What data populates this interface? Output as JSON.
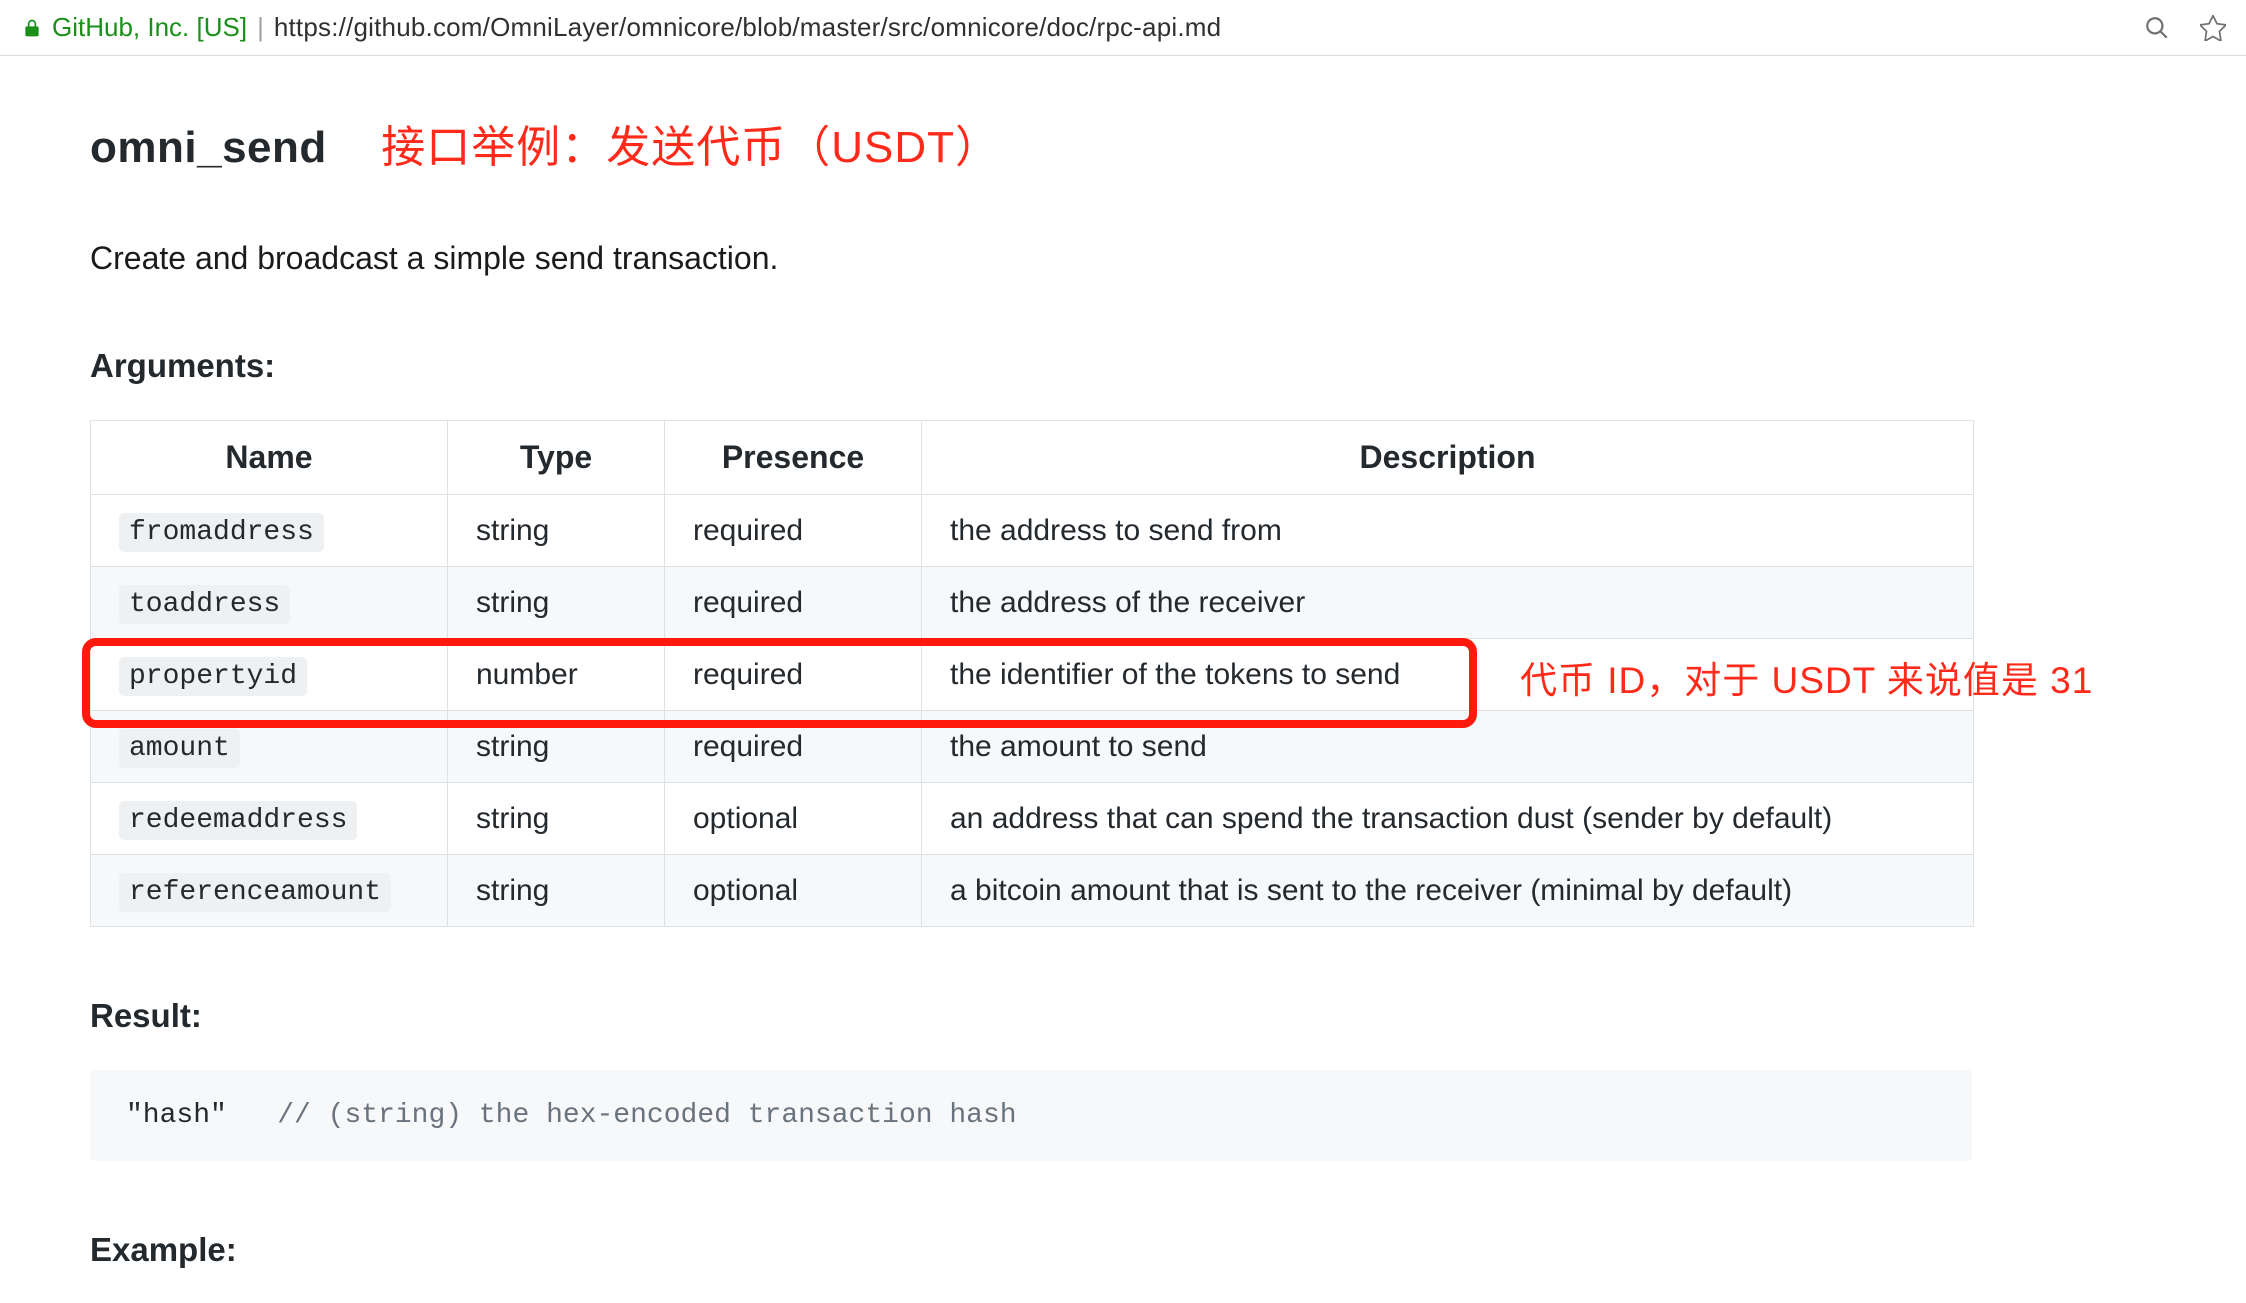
{
  "urlbar": {
    "cert": "GitHub, Inc. [US]",
    "url": "https://github.com/OmniLayer/omnicore/blob/master/src/omnicore/doc/rpc-api.md"
  },
  "doc": {
    "heading": "omni_send",
    "annotation_heading": "接口举例：发送代币（USDT）",
    "lead": "Create and broadcast a simple send transaction.",
    "arguments_label": "Arguments:",
    "result_label": "Result:",
    "example_label": "Example:",
    "table_headers": {
      "name": "Name",
      "type": "Type",
      "presence": "Presence",
      "description": "Description"
    },
    "args": [
      {
        "name": "fromaddress",
        "type": "string",
        "presence": "required",
        "description": "the address to send from"
      },
      {
        "name": "toaddress",
        "type": "string",
        "presence": "required",
        "description": "the address of the receiver"
      },
      {
        "name": "propertyid",
        "type": "number",
        "presence": "required",
        "description": "the identifier of the tokens to send"
      },
      {
        "name": "amount",
        "type": "string",
        "presence": "required",
        "description": "the amount to send"
      },
      {
        "name": "redeemaddress",
        "type": "string",
        "presence": "optional",
        "description": "an address that can spend the transaction dust (sender by default)"
      },
      {
        "name": "referenceamount",
        "type": "string",
        "presence": "optional",
        "description": "a bitcoin amount that is sent to the receiver (minimal by default)"
      }
    ],
    "highlight_row_index": 2,
    "highlight_note": "代币 ID，对于 USDT 来说值是 31",
    "result_code": {
      "text": "\"hash\"",
      "comment": "// (string) the hex-encoded transaction hash"
    }
  }
}
